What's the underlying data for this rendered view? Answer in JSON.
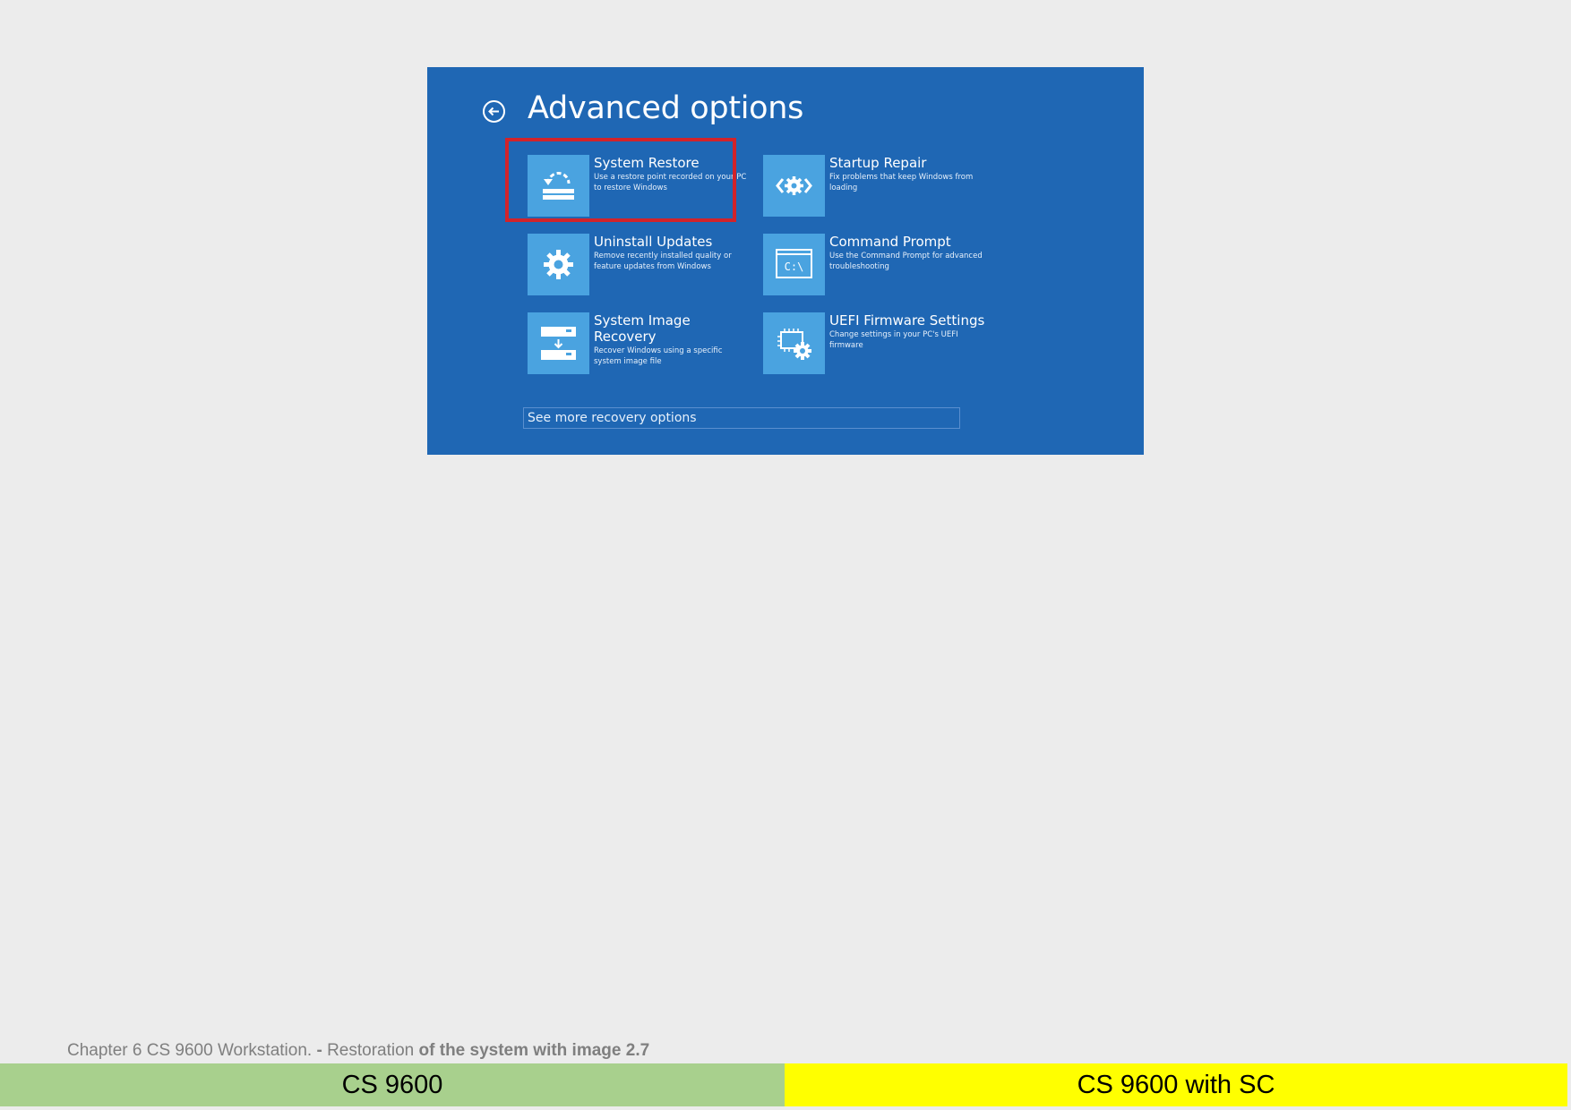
{
  "screen": {
    "title": "Advanced options",
    "back_icon": "back-arrow-circle-icon",
    "options": [
      {
        "title": "System Restore",
        "description": "Use a restore point recorded on your PC to restore Windows",
        "icon": "system-restore-icon",
        "highlighted": true
      },
      {
        "title": "Startup Repair",
        "description": "Fix problems that keep Windows from loading",
        "icon": "startup-repair-icon",
        "highlighted": false
      },
      {
        "title": "Uninstall Updates",
        "description": "Remove recently installed quality or feature updates from Windows",
        "icon": "gear-icon",
        "highlighted": false
      },
      {
        "title": "Command Prompt",
        "description": "Use the Command Prompt for advanced troubleshooting",
        "icon": "command-prompt-icon",
        "icon_text": "C:\\",
        "highlighted": false
      },
      {
        "title": "System Image Recovery",
        "description": "Recover Windows using a specific system image file",
        "icon": "system-image-recovery-icon",
        "highlighted": false
      },
      {
        "title": "UEFI Firmware Settings",
        "description": "Change settings in your PC's UEFI firmware",
        "icon": "uefi-firmware-icon",
        "highlighted": false
      }
    ],
    "more_options": "See more recovery options"
  },
  "footer": {
    "caption_part1": "Chapter 6 CS 9600 Workstation.",
    "caption_part2": " - ",
    "caption_part3": "Restoration ",
    "caption_part4": "of the system with image 2.7",
    "left_label": "CS 9600",
    "right_label": "CS 9600 with SC"
  },
  "colors": {
    "screen_background": "#1f67b4",
    "tile": "#4aa3e0",
    "highlight": "#d2232a",
    "left_bar": "#a8d08d",
    "right_bar": "#ffff00",
    "page_background": "#ececec"
  }
}
